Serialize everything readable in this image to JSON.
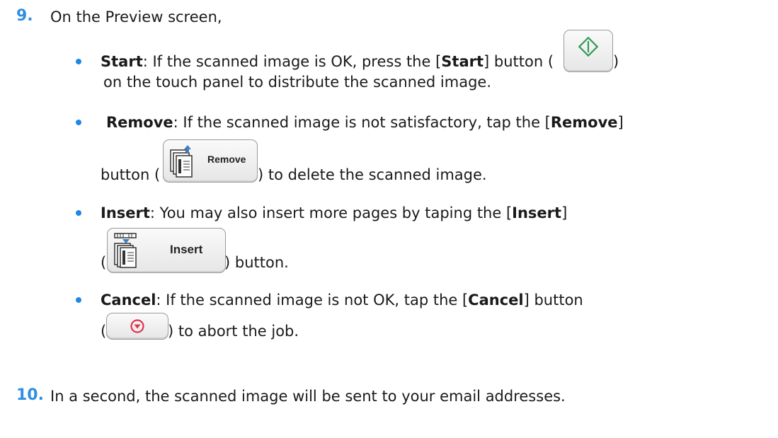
{
  "steps": [
    {
      "number": "9.",
      "text": "On the Preview screen,"
    },
    {
      "number": "10.",
      "text": "In a second, the scanned image will be sent to your email addresses."
    }
  ],
  "bullets": {
    "start": {
      "term": "Start",
      "line1_a": ": If the scanned image is OK, press the [",
      "line1_b": "Start",
      "line1_c": "] button (",
      "line1_close": ")",
      "line2": "on the touch panel to distribute the scanned image."
    },
    "remove": {
      "term": "Remove",
      "line1_a": ": If the scanned image is not satisfactory, tap the [",
      "line1_b": "Remove",
      "line1_c": "]",
      "line2_a": "button (",
      "line2_b": ") to delete the scanned image.",
      "button_label": "Remove"
    },
    "insert": {
      "term": "Insert",
      "line1_a": ": You may also insert more pages by taping the [",
      "line1_b": "Insert",
      "line1_c": "]",
      "line2_a": "(",
      "line2_b": ") button.",
      "button_label": "Insert"
    },
    "cancel": {
      "term": "Cancel",
      "line1_a": ": If the scanned image is not OK, tap the [",
      "line1_b": "Cancel",
      "line1_c": "] button",
      "line2_a": "(",
      "line2_b": ") to abort the job."
    }
  },
  "colors": {
    "accent": "#2f8fe0",
    "start_icon": "#2e9b57",
    "cancel_icon": "#e0344a"
  }
}
